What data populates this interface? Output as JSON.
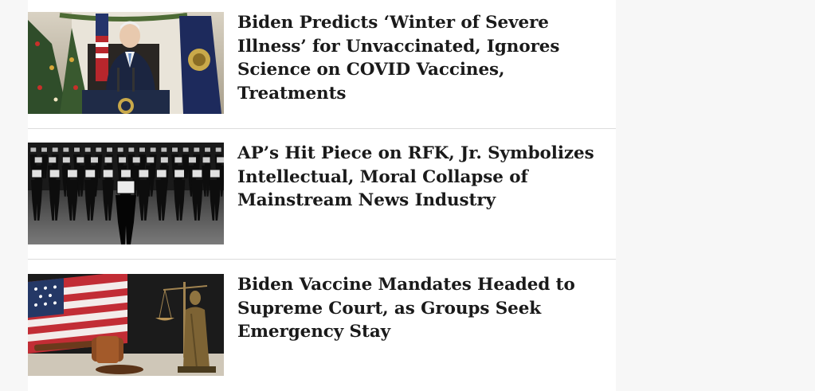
{
  "articles": [
    {
      "headline": "Biden Predicts ‘Winter of Severe Illness’ for Unvaccinated, Ignores Science on COVID Vaccines, Treatments",
      "image": "president-at-podium-with-flags-and-christmas-tree"
    },
    {
      "headline": "AP’s Hit Piece on RFK, Jr. Symbolizes Intellectual, Moral Collapse of Mainstream News Industry",
      "image": "crowd-of-tv-headed-figures"
    },
    {
      "headline": "Biden Vaccine Mandates Headed to Supreme Court, as Groups Seek Emergency Stay",
      "image": "american-flag-gavel-and-lady-justice"
    }
  ]
}
